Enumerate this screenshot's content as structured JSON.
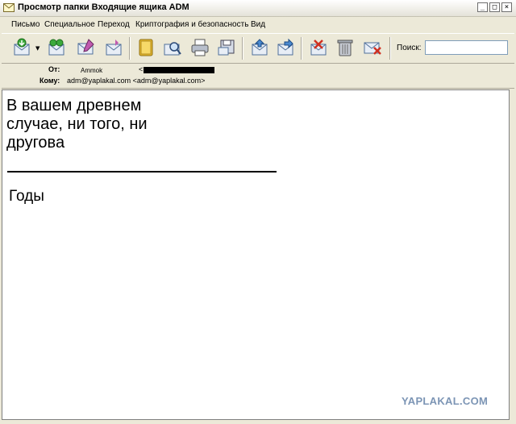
{
  "window": {
    "title": "Просмотр папки Входящие ящика ADM",
    "buttons": {
      "minimize": "_",
      "maximize": "□",
      "close": "×"
    }
  },
  "menu": {
    "items": [
      "Письмо",
      "Специальное",
      "Переход",
      "Криптография и безопасность",
      "Вид"
    ]
  },
  "toolbar": {
    "icons": [
      "get-mail-icon",
      "send-receive-icon",
      "new-message-icon",
      "reply-icon",
      "address-book-icon",
      "search-messages-icon",
      "print-icon",
      "save-icon",
      "previous-icon",
      "next-icon",
      "mark-spam-icon",
      "trash-icon",
      "delete-icon"
    ],
    "search_label": "Поиск:",
    "search_value": ""
  },
  "header": {
    "from_label": "От:",
    "from_value": "Ammok",
    "from_email_open": "<",
    "to_label": "Кому:",
    "to_value": "adm@yaplakal.com <adm@yaplakal.com>"
  },
  "message": {
    "lines": [
      "В вашем древнем",
      "случае, ни того, ни",
      "другова"
    ],
    "signature": "Годы"
  },
  "watermark": "YAPLAKAL.COM"
}
